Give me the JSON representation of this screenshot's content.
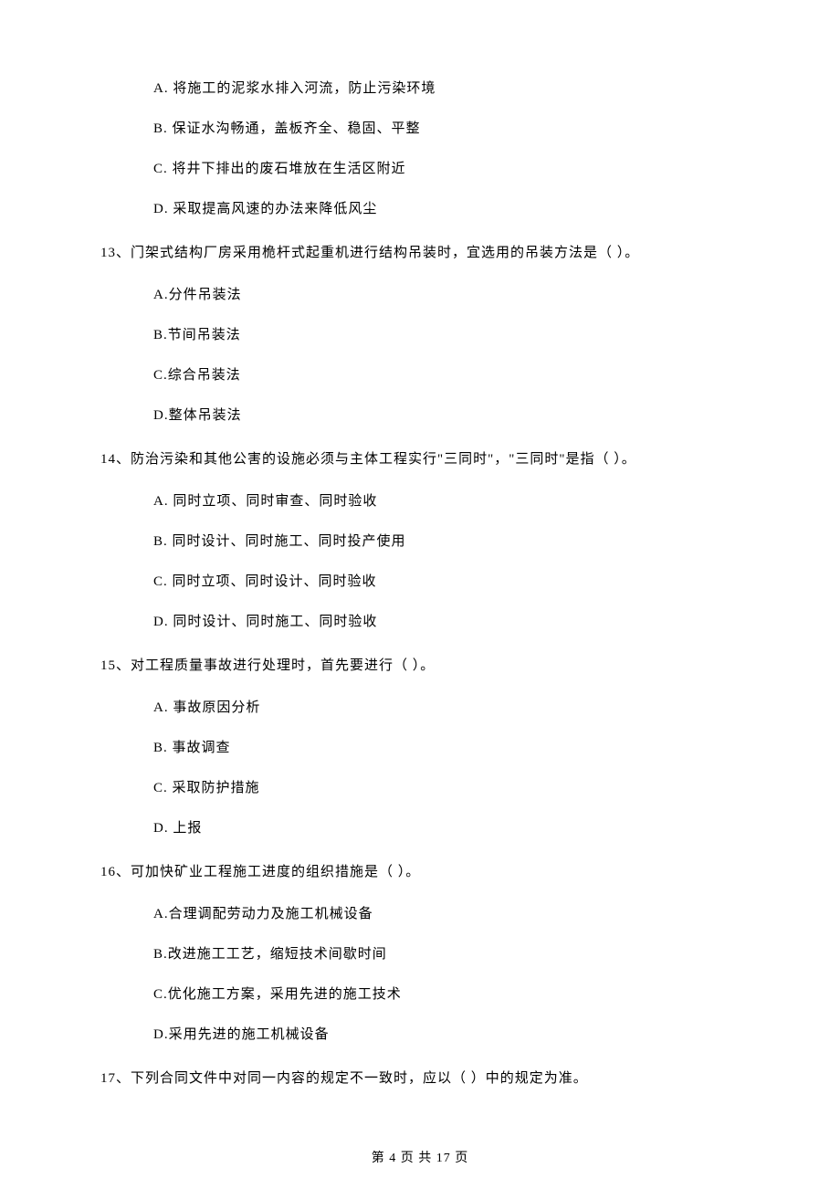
{
  "q12": {
    "optA": "A.  将施工的泥浆水排入河流，防止污染环境",
    "optB": "B.  保证水沟畅通，盖板齐全、稳固、平整",
    "optC": "C.  将井下排出的废石堆放在生活区附近",
    "optD": "D.  采取提高风速的办法来降低风尘"
  },
  "q13": {
    "stem": "13、门架式结构厂房采用桅杆式起重机进行结构吊装时，宜选用的吊装方法是（    ）。",
    "optA": "A.分件吊装法",
    "optB": "B.节间吊装法",
    "optC": "C.综合吊装法",
    "optD": "D.整体吊装法"
  },
  "q14": {
    "stem": "14、防治污染和其他公害的设施必须与主体工程实行\"三同时\"，\"三同时\"是指（    ）。",
    "optA": "A.  同时立项、同时审查、同时验收",
    "optB": "B.  同时设计、同时施工、同时投产使用",
    "optC": "C.  同时立项、同时设计、同时验收",
    "optD": "D.  同时设计、同时施工、同时验收"
  },
  "q15": {
    "stem": "15、对工程质量事故进行处理时，首先要进行（    ）。",
    "optA": "A.  事故原因分析",
    "optB": "B.  事故调查",
    "optC": "C.  采取防护措施",
    "optD": "D.  上报"
  },
  "q16": {
    "stem": "16、可加快矿业工程施工进度的组织措施是（    ）。",
    "optA": "A.合理调配劳动力及施工机械设备",
    "optB": "B.改进施工工艺，缩短技术间歇时间",
    "optC": "C.优化施工方案，采用先进的施工技术",
    "optD": "D.采用先进的施工机械设备"
  },
  "q17": {
    "stem": "17、下列合同文件中对同一内容的规定不一致时，应以（    ）中的规定为准。"
  },
  "footer": "第 4 页 共 17 页"
}
